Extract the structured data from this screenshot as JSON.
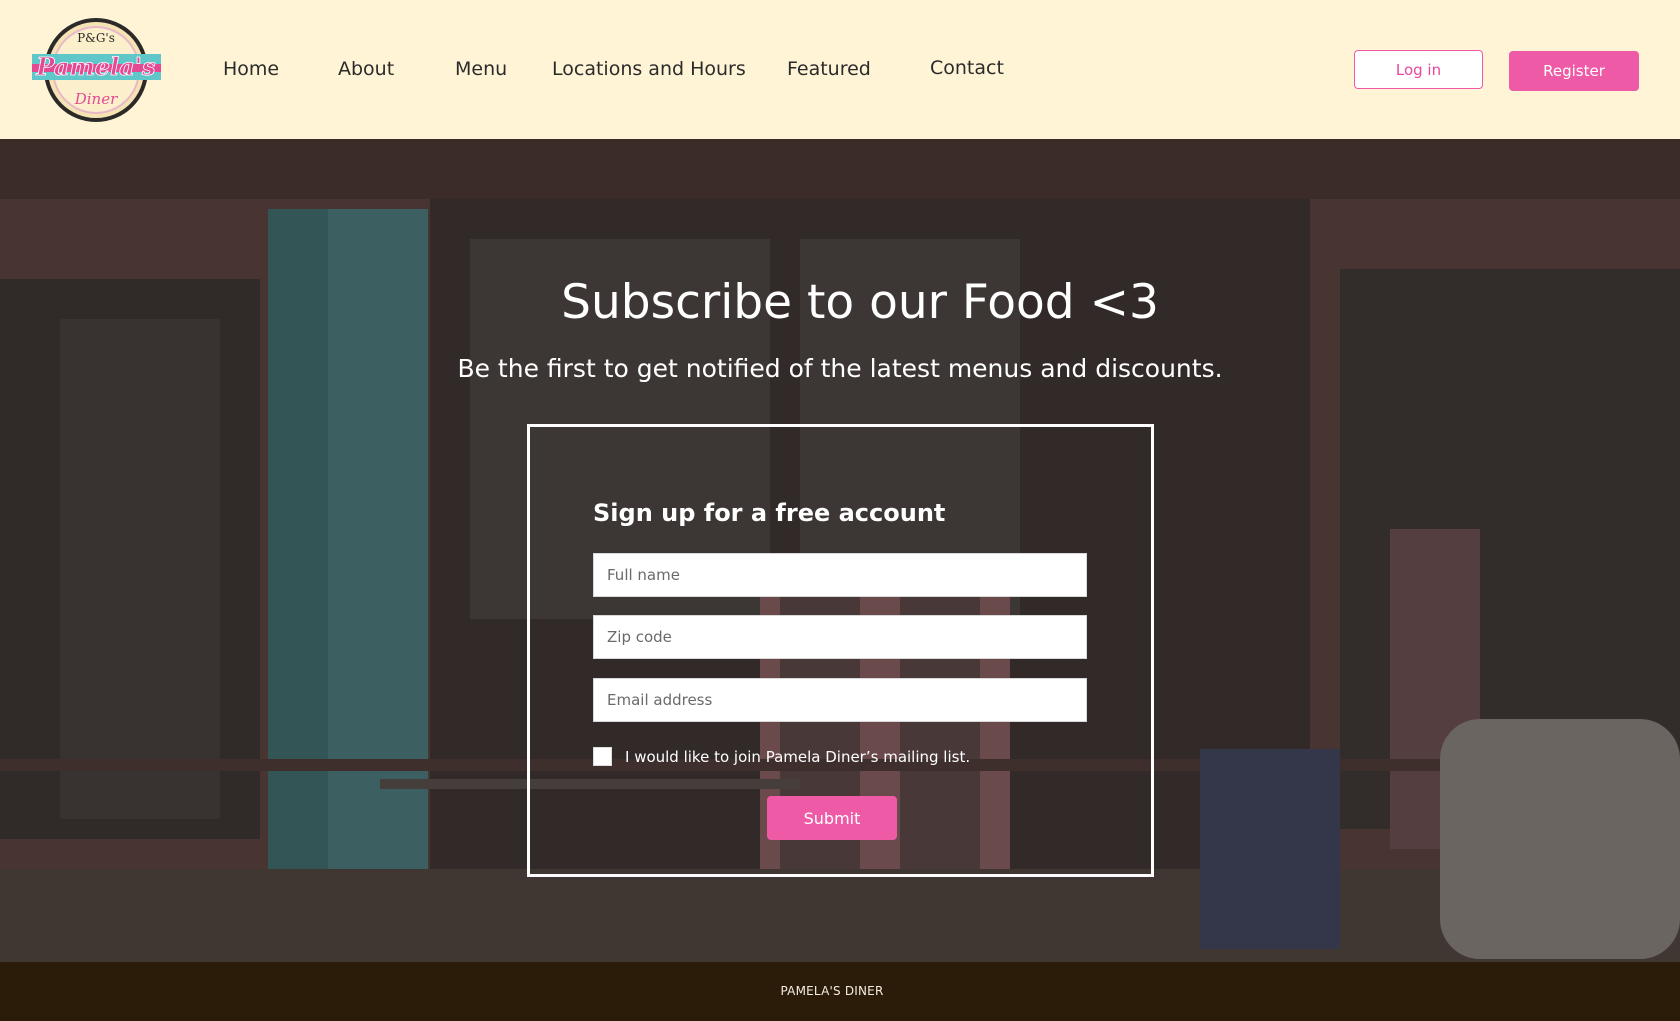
{
  "brand": {
    "logo_top": "P&G's",
    "logo_main": "Pamela's",
    "logo_bottom": "Diner"
  },
  "nav": {
    "items": [
      {
        "label": "Home"
      },
      {
        "label": "About"
      },
      {
        "label": "Menu"
      },
      {
        "label": "Locations and Hours"
      },
      {
        "label": "Featured"
      },
      {
        "label": "Contact"
      }
    ]
  },
  "auth": {
    "login_label": "Log in",
    "register_label": "Register"
  },
  "hero": {
    "title": "Subscribe to our Food <3",
    "subtitle": "Be the first to get notified of the latest menus and discounts.",
    "form": {
      "title": "Sign up for a free account",
      "fields": [
        {
          "placeholder": "Full name",
          "value": ""
        },
        {
          "placeholder": "Zip code",
          "value": ""
        },
        {
          "placeholder": "Email address",
          "value": ""
        }
      ],
      "checkbox_label": "I would like to join Pamela Diner’s mailing list.",
      "checkbox_checked": false,
      "submit_label": "Submit"
    }
  },
  "footer": {
    "text": "PAMELA'S DINER"
  },
  "colors": {
    "header_bg": "#fff5d6",
    "accent_pink": "#ee5aa6",
    "footer_bg": "#2a1c08",
    "logo_teal": "#5fc6c9"
  }
}
